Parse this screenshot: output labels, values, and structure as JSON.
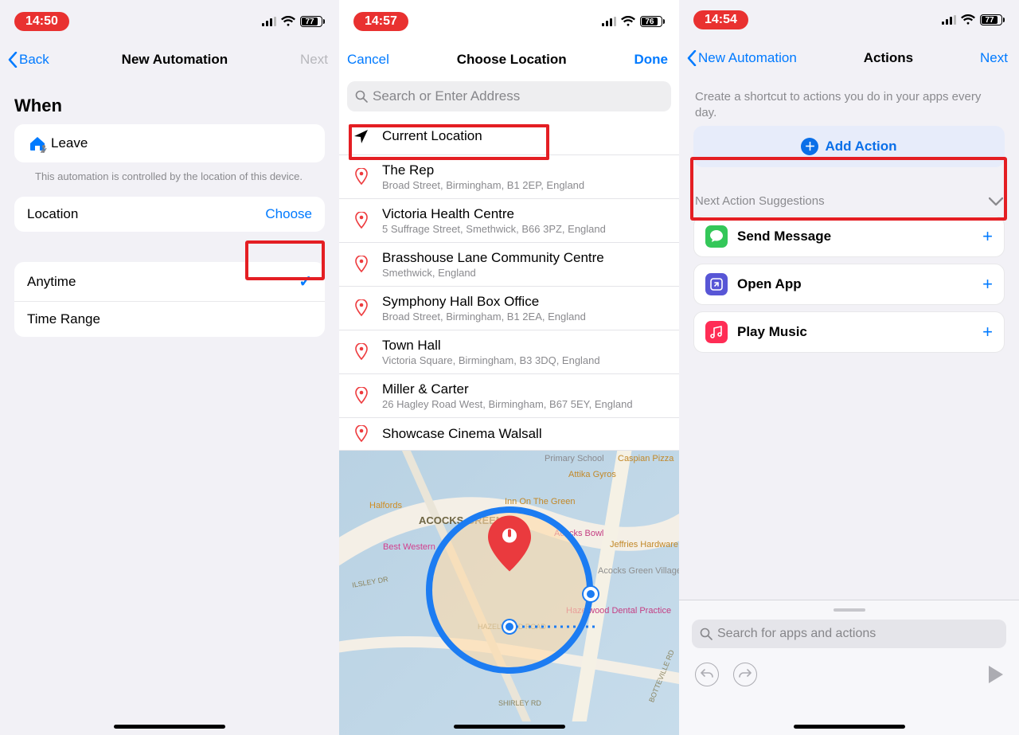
{
  "screens": {
    "s1": {
      "time": "14:50",
      "battery": "77",
      "nav": {
        "back": "Back",
        "title": "New Automation",
        "next": "Next"
      },
      "section_when": "When",
      "when_action": "Leave",
      "hint": "This automation is controlled by the location of this device.",
      "location_row": {
        "label": "Location",
        "choose": "Choose"
      },
      "time_options": {
        "anytime": "Anytime",
        "timerange": "Time Range"
      }
    },
    "s2": {
      "time": "14:57",
      "battery": "76",
      "nav": {
        "cancel": "Cancel",
        "title": "Choose Location",
        "done": "Done"
      },
      "search_placeholder": "Search or Enter Address",
      "current_location": "Current Location",
      "locations": [
        {
          "name": "The Rep",
          "addr": "Broad Street, Birmingham, B1 2EP, England"
        },
        {
          "name": "Victoria Health Centre",
          "addr": "5 Suffrage Street, Smethwick, B66 3PZ, England"
        },
        {
          "name": "Brasshouse Lane Community Centre",
          "addr": "Smethwick, England"
        },
        {
          "name": "Symphony Hall Box Office",
          "addr": "Broad Street, Birmingham, B1 2EA, England"
        },
        {
          "name": "Town Hall",
          "addr": "Victoria Square, Birmingham, B3 3DQ, England"
        },
        {
          "name": "Miller & Carter",
          "addr": "26 Hagley Road West, Birmingham, B67 5EY, England"
        },
        {
          "name": "Showcase Cinema Walsall",
          "addr": ""
        }
      ],
      "map_labels": {
        "area": "ACOCKS GREEN",
        "bw": "Best Western",
        "halfords": "Halfords",
        "inn": "Inn On The Green",
        "bowl": "Acocks Bowl",
        "jeff": "Jeffries Hardware",
        "bid": "Acocks Green Village Bid",
        "dental": "Hazelwood Dental Practice",
        "rd": "HAZELWOOD ROAD",
        "ilsley": "ILSLEY DR",
        "primary": "Primary School",
        "caspian": "Caspian Pizza",
        "gyros": "Attika Gyros",
        "bott": "BOTTEVILLE RD",
        "shirley": "SHIRLEY RD"
      }
    },
    "s3": {
      "time": "14:54",
      "battery": "77",
      "nav": {
        "back": "New Automation",
        "title": "Actions",
        "next": "Next"
      },
      "subtext": "Create a shortcut to actions you do in your apps every day.",
      "add_action": "Add Action",
      "suggestions_head": "Next Action Suggestions",
      "suggestions": [
        {
          "label": "Send Message",
          "color": "#34c759",
          "glyph": "msg"
        },
        {
          "label": "Open App",
          "color": "#5856d6",
          "glyph": "open"
        },
        {
          "label": "Play Music",
          "color": "#ff2d55",
          "glyph": "music"
        }
      ],
      "dock_search": "Search for apps and actions"
    }
  }
}
